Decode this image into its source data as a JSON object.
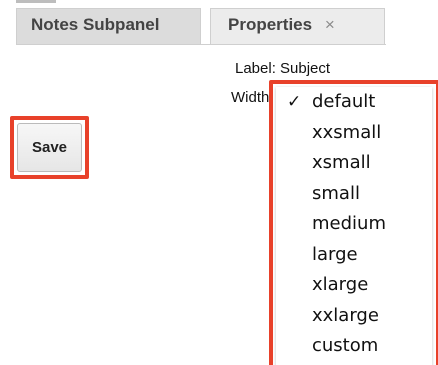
{
  "tabs": {
    "inactive_label": "Notes Subpanel",
    "active_label": "Properties",
    "close_glyph": "×"
  },
  "properties": {
    "label_text": "Label: Subject",
    "width_text": "Width"
  },
  "buttons": {
    "save_label": "Save"
  },
  "dropdown": {
    "selected": "default",
    "checkmark": "✓",
    "options": [
      "default",
      "xxsmall",
      "xsmall",
      "small",
      "medium",
      "large",
      "xlarge",
      "xxlarge",
      "custom"
    ]
  },
  "colors": {
    "highlight": "#e8412a",
    "tab_inactive": "#dcdcdc",
    "tab_active": "#ececec"
  }
}
